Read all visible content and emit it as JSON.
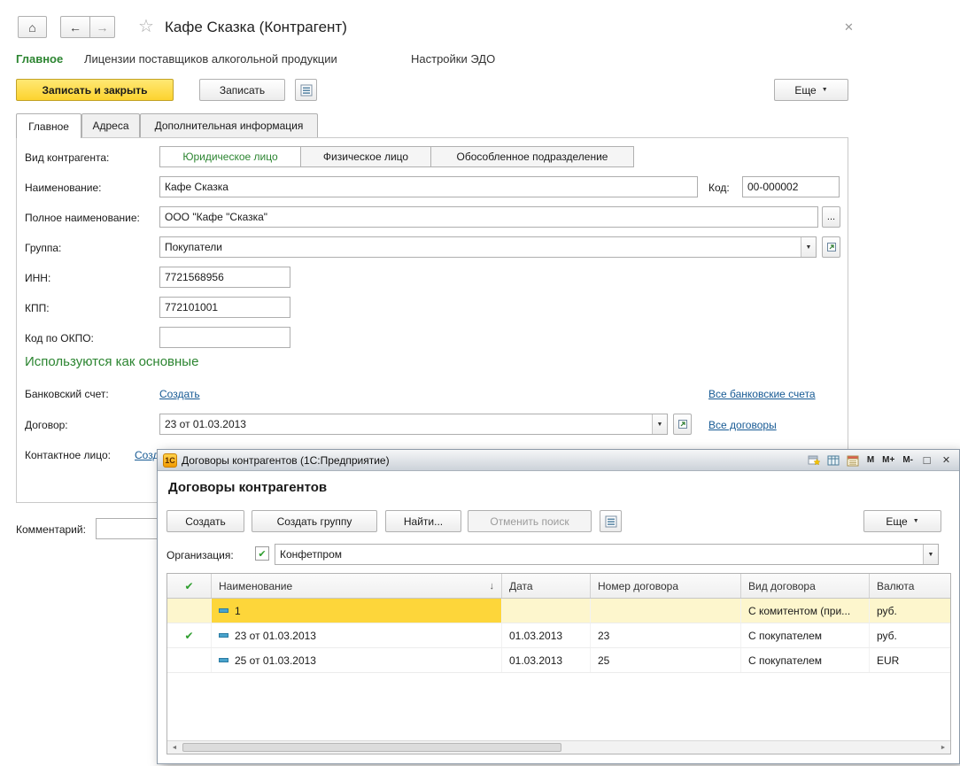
{
  "colors": {
    "accent_yellow": "#FCD32E",
    "link_blue": "#175A94",
    "green": "#2C8531",
    "selected_row": "#FDF6CD",
    "focused_cell": "#FDD63A"
  },
  "icons": {
    "home": "⌂",
    "back": "←",
    "forward": "→",
    "star": "☆",
    "close": "✕",
    "dropdown": "▼",
    "ellipsis": "...",
    "check": "✔",
    "sort_desc": "↓",
    "maximize": "□",
    "scroll_left": "◄",
    "scroll_right": "►"
  },
  "main": {
    "title": "Кафе Сказка (Контрагент)",
    "nav": {
      "home": "Главное",
      "licenses": "Лицензии поставщиков алкогольной продукции",
      "edo": "Настройки ЭДО"
    },
    "toolbar": {
      "save_close": "Записать и закрыть",
      "save": "Записать",
      "more": "Еще"
    },
    "tabs": {
      "main": "Главное",
      "addresses": "Адреса",
      "additional": "Дополнительная информация"
    },
    "form": {
      "kind": {
        "label": "Вид контрагента:",
        "legal": "Юридическое лицо",
        "individual": "Физическое лицо",
        "division": "Обособленное подразделение"
      },
      "name": {
        "label": "Наименование:",
        "value": "Кафе Сказка"
      },
      "code": {
        "label": "Код:",
        "value": "00-000002"
      },
      "full_name": {
        "label": "Полное наименование:",
        "value": "ООО \"Кафе \"Сказка\""
      },
      "group": {
        "label": "Группа:",
        "value": "Покупатели"
      },
      "inn": {
        "label": "ИНН:",
        "value": "7721568956"
      },
      "kpp": {
        "label": "КПП:",
        "value": "772101001"
      },
      "okpo": {
        "label": "Код по ОКПО:",
        "value": ""
      },
      "section_main": "Используются как основные",
      "bank": {
        "label": "Банковский счет:",
        "create": "Создать",
        "all": "Все банковские счета"
      },
      "contract": {
        "label": "Договор:",
        "value": "23  от 01.03.2013",
        "all": "Все договоры"
      },
      "contact": {
        "label": "Контактное лицо:",
        "create": "Создать"
      },
      "comment": {
        "label": "Комментарий:"
      }
    }
  },
  "dialog": {
    "titlebar": {
      "logo": "1С",
      "title": "Договоры контрагентов (1С:Предприятие)",
      "m": "M",
      "m_plus": "M+",
      "m_minus": "M-"
    },
    "heading": "Договоры контрагентов",
    "toolbar": {
      "create": "Создать",
      "create_group": "Создать группу",
      "find": "Найти...",
      "cancel_search": "Отменить поиск",
      "more": "Еще"
    },
    "org": {
      "label": "Организация:",
      "value": "Конфетпром"
    },
    "table": {
      "headers": {
        "name": "Наименование",
        "date": "Дата",
        "number": "Номер договора",
        "kind": "Вид договора",
        "currency": "Валюта"
      },
      "rows": [
        {
          "marked": false,
          "group": true,
          "selected": true,
          "name": "1",
          "date": "",
          "number": "",
          "kind": "С комитентом (при...",
          "currency": "руб."
        },
        {
          "marked": true,
          "group": false,
          "selected": false,
          "name": "23  от 01.03.2013",
          "date": "01.03.2013",
          "number": "23",
          "kind": "С покупателем",
          "currency": "руб."
        },
        {
          "marked": false,
          "group": false,
          "selected": false,
          "name": "25 от 01.03.2013",
          "date": "01.03.2013",
          "number": "25",
          "kind": "С покупателем",
          "currency": "EUR"
        }
      ]
    }
  }
}
